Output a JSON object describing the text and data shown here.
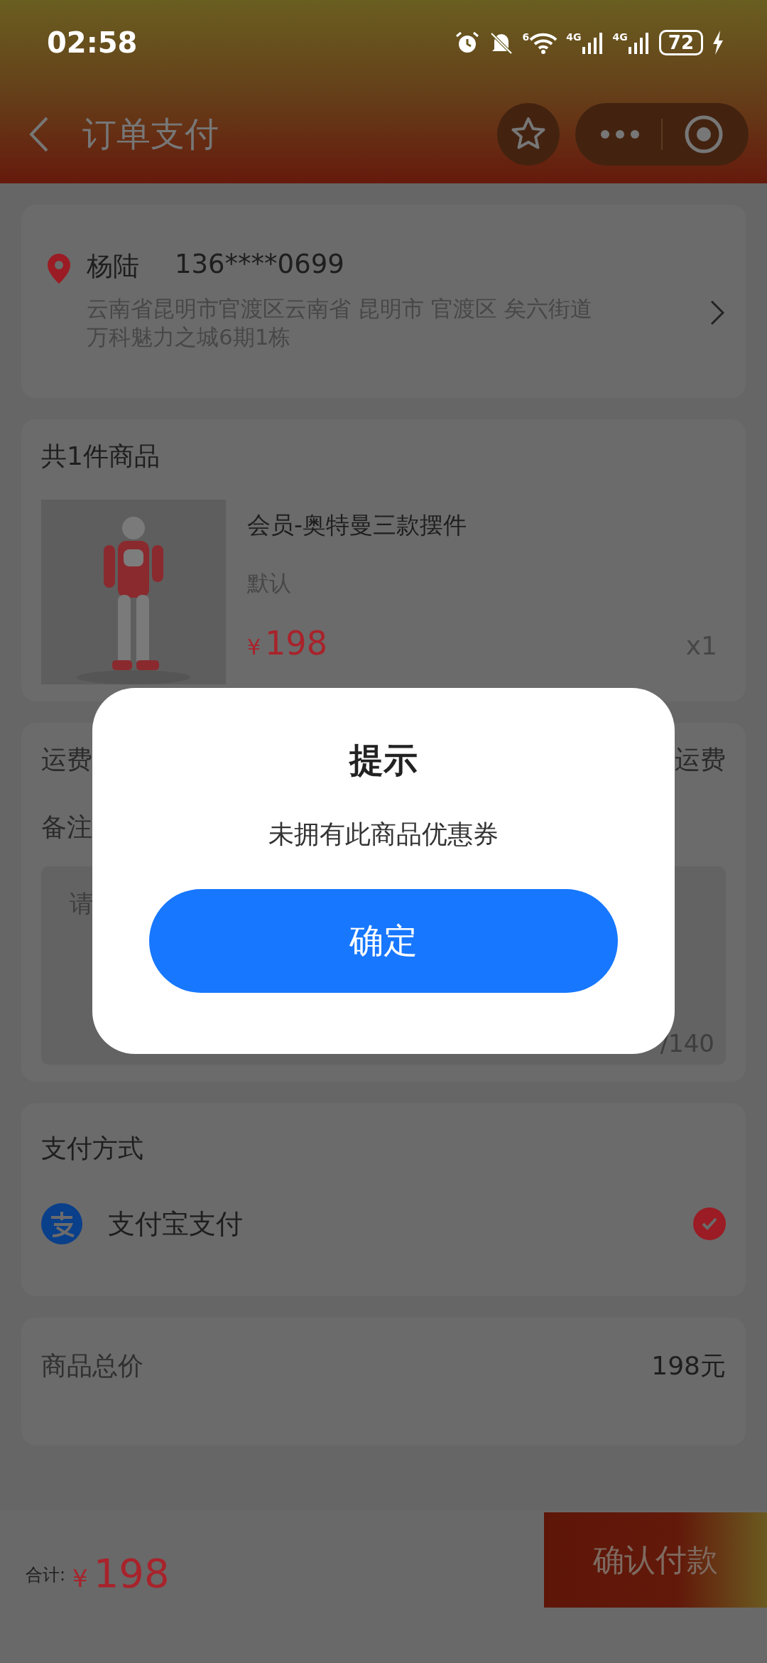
{
  "status_bar": {
    "time": "02:58",
    "wifi_badge": "6",
    "signals": [
      "4G",
      "4G"
    ],
    "battery": "72"
  },
  "header": {
    "title": "订单支付"
  },
  "address": {
    "name": "杨陆",
    "phone": "136****0699",
    "lines": [
      "云南省昆明市官渡区云南省 昆明市 官渡区 矣六街道",
      "万科魅力之城6期1栋"
    ]
  },
  "goods": {
    "title": "共1件商品",
    "items": [
      {
        "kind": "picture",
        "name": "会员-奥特曼三款摆件",
        "spec": "默认",
        "currency": "¥",
        "price": "198",
        "quantity": "x1"
      }
    ]
  },
  "freight": {
    "label": "运费",
    "value": "运费"
  },
  "remark": {
    "label": "备注",
    "placeholder": "请",
    "counter": "/140"
  },
  "payment": {
    "title": "支付方式",
    "methods": [
      {
        "name": "支付宝支付",
        "selected": true
      }
    ]
  },
  "summary": {
    "label": "商品总价",
    "value": "198元"
  },
  "bottom_bar": {
    "label": "合计:",
    "currency": "¥",
    "amount": "198",
    "button": "确认付款"
  },
  "dialog": {
    "title": "提示",
    "message": "未拥有此商品优惠券",
    "button": "确定"
  }
}
